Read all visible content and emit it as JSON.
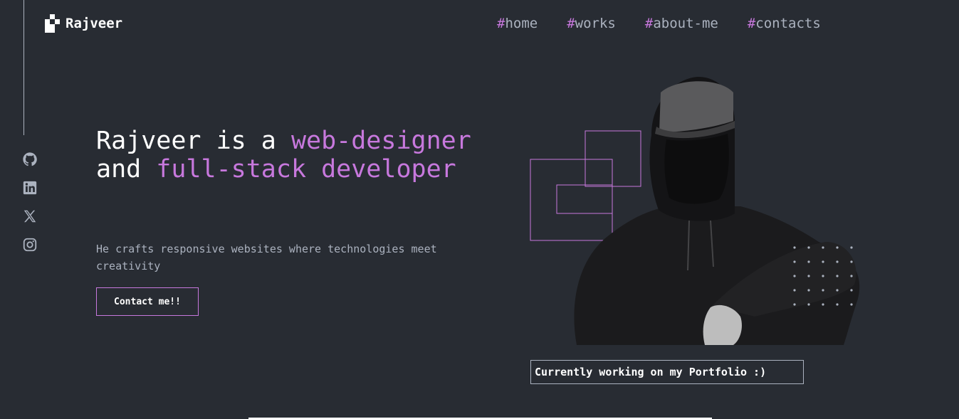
{
  "brand": {
    "name": "Rajveer",
    "logo_icon": "pixel-logo-icon"
  },
  "nav": {
    "hash": "#",
    "items": [
      {
        "label": "home"
      },
      {
        "label": "works"
      },
      {
        "label": "about-me"
      },
      {
        "label": "contacts"
      }
    ]
  },
  "socials": [
    "github-icon",
    "linkedin-icon",
    "x-icon",
    "instagram-icon"
  ],
  "hero": {
    "title_part1": "Rajveer is a ",
    "title_accent1": "web-designer",
    "title_part2": " and ",
    "title_accent2": "full-stack developer",
    "subtitle": "He crafts responsive websites where technologies meet creativity",
    "cta_label": "Contact me!!",
    "status": "Currently working on my Portfolio :)"
  },
  "colors": {
    "background": "#282c33",
    "accent": "#c778dd",
    "text": "#ffffff",
    "muted": "#abb2bf"
  }
}
